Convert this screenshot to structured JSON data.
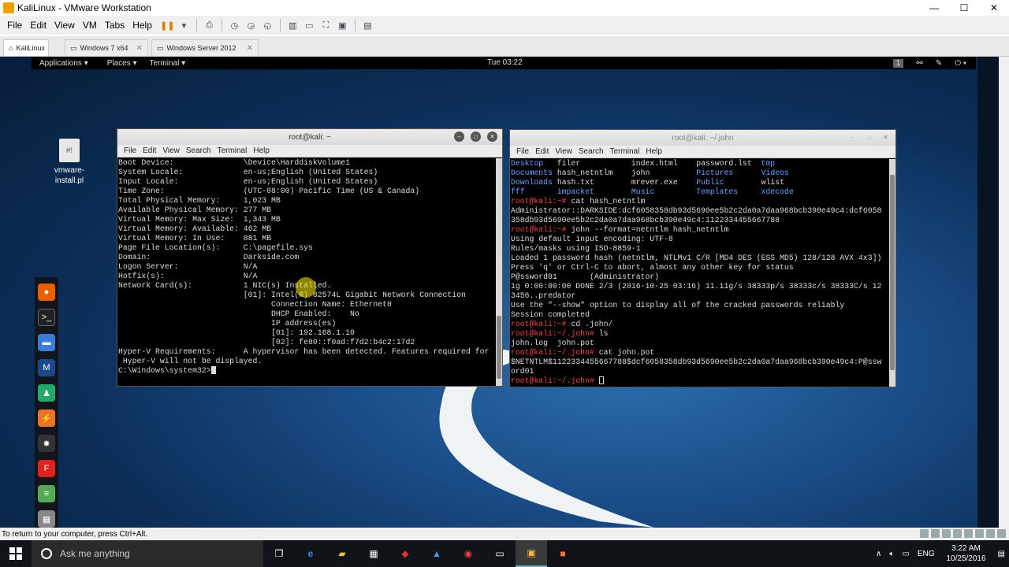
{
  "window": {
    "title": "KaliLinux - VMware Workstation",
    "min": "—",
    "max": "☐",
    "close": "✕"
  },
  "menu": [
    "File",
    "Edit",
    "View",
    "VM",
    "Tabs",
    "Help"
  ],
  "tabs": [
    {
      "label": "KaliLinux",
      "active": true
    },
    {
      "label": "Windows 7 x64",
      "active": false
    },
    {
      "label": "Windows Server 2012",
      "active": false
    }
  ],
  "topbar": {
    "applications": "Applications ▾",
    "places": "Places ▾",
    "terminal": "Terminal ▾",
    "clock": "Tue 03:22",
    "ws": "1"
  },
  "desktop_icon": {
    "label1": "vmware-",
    "label2": "install.pl",
    "glyph": "#!"
  },
  "term1": {
    "title": "root@kali: ~",
    "menu": [
      "File",
      "Edit",
      "View",
      "Search",
      "Terminal",
      "Help"
    ],
    "lines": [
      "Boot Device:               \\Device\\HarddiskVolume1",
      "System Locale:             en-us;English (United States)",
      "Input Locale:              en-us;English (United States)",
      "Time Zone:                 (UTC-08:00) Pacific Time (US & Canada)",
      "Total Physical Memory:     1,023 MB",
      "Available Physical Memory: 277 MB",
      "Virtual Memory: Max Size:  1,343 MB",
      "Virtual Memory: Available: 462 MB",
      "Virtual Memory: In Use:    881 MB",
      "Page File Location(s):     C:\\pagefile.sys",
      "Domain:                    Darkside.com",
      "Logon Server:              N/A",
      "Hotfix(s):                 N/A",
      "Network Card(s):           1 NIC(s) Installed.",
      "                           [01]: Intel(R) 82574L Gigabit Network Connection",
      "                                 Connection Name: Ethernet0",
      "                                 DHCP Enabled:    No",
      "                                 IP address(es)",
      "                                 [01]: 192.168.1.10",
      "                                 [02]: fe80::f0ad:f7d2:b4c2:17d2",
      "Hyper-V Requirements:      A hypervisor has been detected. Features required for",
      " Hyper-V will not be displayed.",
      "",
      "C:\\Windows\\system32>"
    ]
  },
  "term2": {
    "title": "root@kali: ~/.john",
    "menu": [
      "File",
      "Edit",
      "View",
      "Search",
      "Terminal",
      "Help"
    ],
    "ls": [
      [
        "Desktop",
        "filer",
        "index.html",
        "password.lst",
        "tmp"
      ],
      [
        "Documents",
        "hash_netntlm",
        "john",
        "Pictures",
        "Videos"
      ],
      [
        "Downloads",
        "hash.txt",
        "mrever.exe",
        "Public",
        "wlist"
      ],
      [
        "fff",
        "impacket",
        "Music",
        "Templates",
        "xdecode"
      ]
    ],
    "p_home": "root@kali:~#",
    "p_john": "root@kali:~/.john#",
    "c1": " cat hash_netntlm",
    "o1": [
      "Administrator::DARKSIDE:dcf6058358db93d5690ee5b2c2da0a7daa968bcb390e49c4:dcf6058",
      "358db93d5690ee5b2c2da0a7daa968bcb390e49c4:1122334455667788"
    ],
    "c2": " john --format=netntlm hash_netntlm",
    "o2": [
      "Using default input encoding: UTF-8",
      "Rules/masks using ISO-8859-1",
      "Loaded 1 password hash (netntlm, NTLMv1 C/R [MD4 DES (ESS MD5) 128/128 AVX 4x3])",
      "Press 'q' or Ctrl-C to abort, almost any other key for status",
      "P@ssword01       (Administrator)",
      "1g 0:00:00:00 DONE 2/3 (2016-10-25 03:16) 11.11g/s 38333p/s 38333c/s 38333C/s 12",
      "3456..predator",
      "Use the \"--show\" option to display all of the cracked passwords reliably",
      "Session completed"
    ],
    "c3": " cd .john/",
    "c4": " ls",
    "o4": "john.log  john.pot",
    "c5": " cat john.pot",
    "o5": [
      "$NETNTLM$1122334455667788$dcf6058358db93d5690ee5b2c2da0a7daa968bcb390e49c4:P@ssw",
      "ord01"
    ]
  },
  "statusbar": "To return to your computer, press Ctrl+Alt.",
  "taskbar": {
    "search": "Ask me anything",
    "lang": "ENG",
    "time": "3:22 AM",
    "date": "10/25/2016"
  }
}
